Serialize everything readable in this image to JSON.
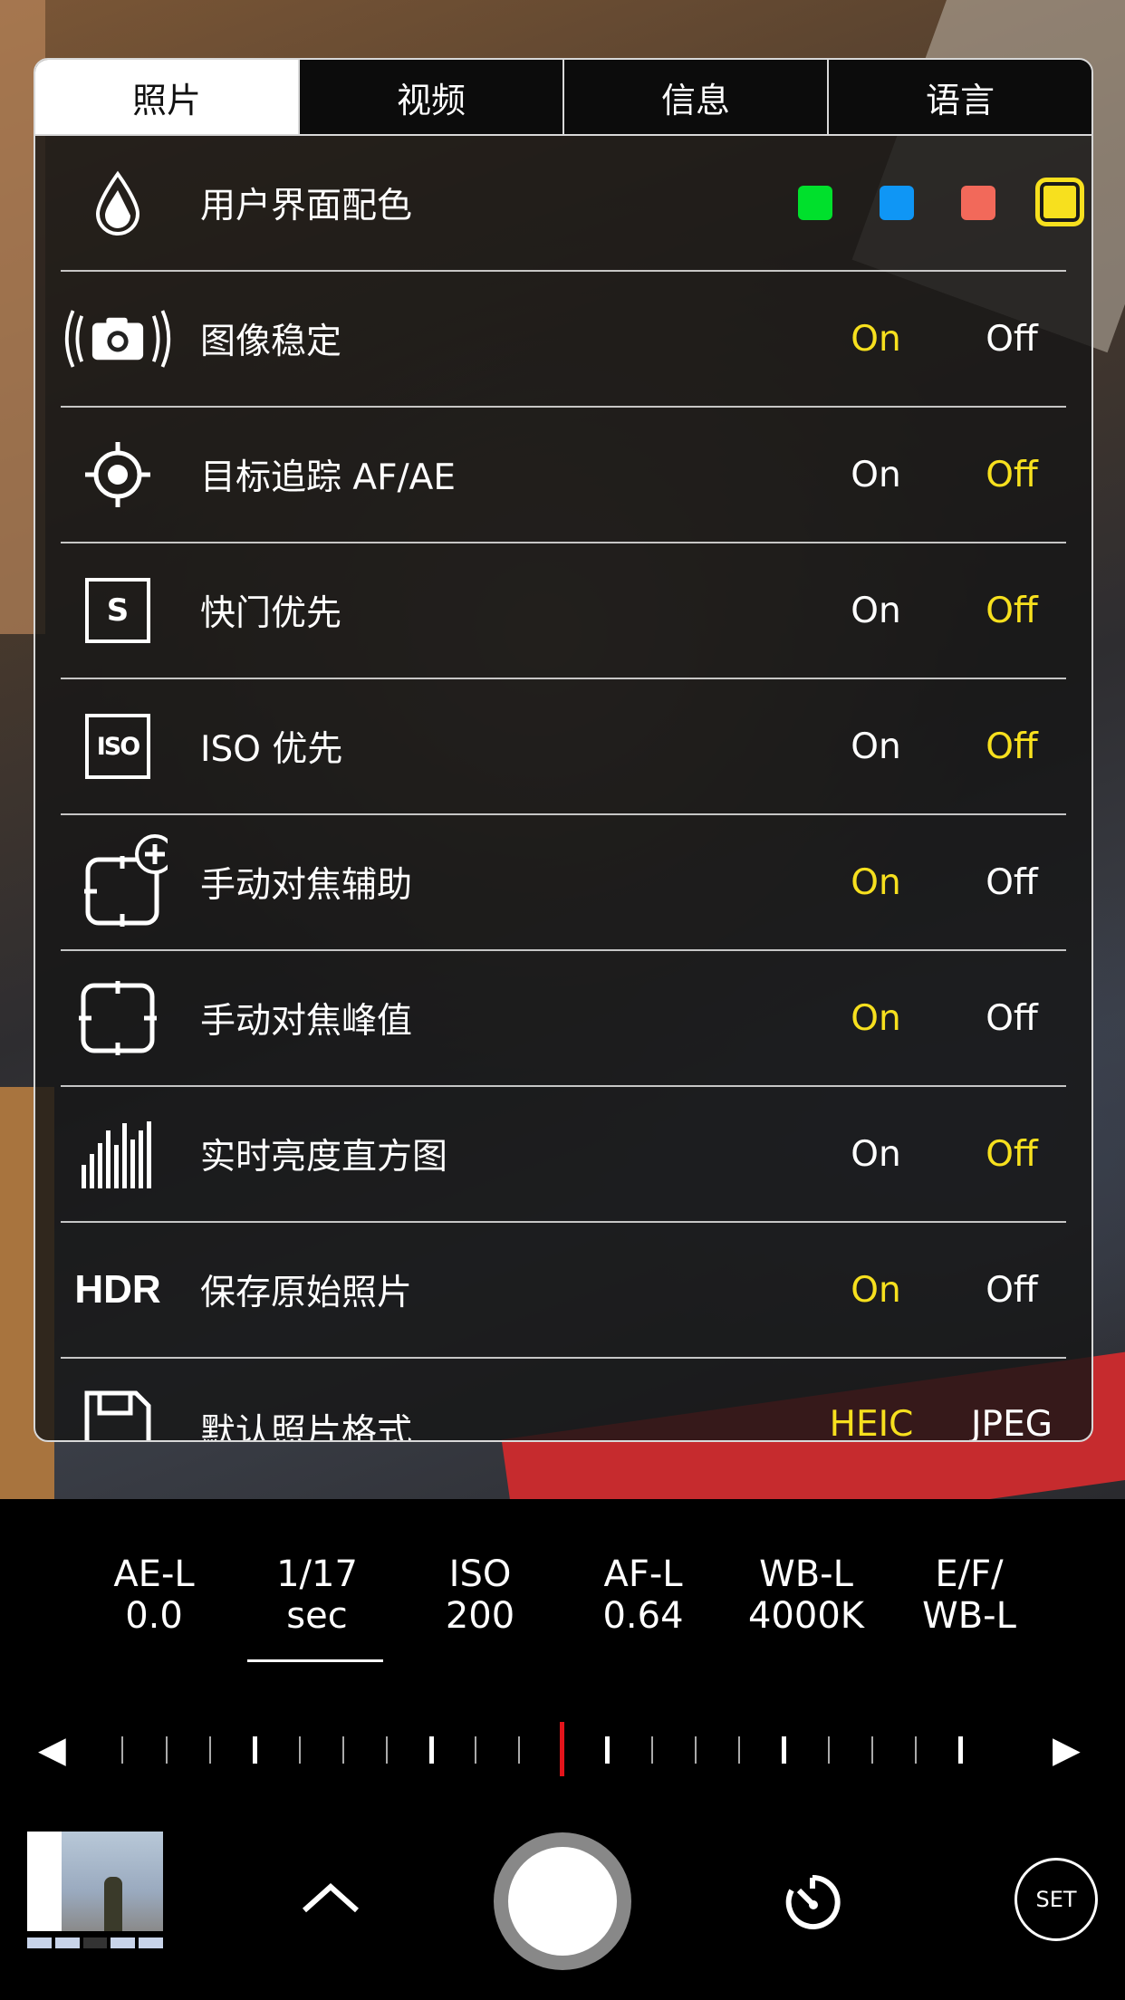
{
  "tabs": [
    "照片",
    "视频",
    "信息",
    "语言"
  ],
  "rows": [
    {
      "label": "用户界面配色",
      "icon": "droplet-icon"
    },
    {
      "label": "图像稳定",
      "icon": "camera-stabilization-icon",
      "on": "On",
      "off": "Off",
      "selected": "On"
    },
    {
      "label": "目标追踪 AF/AE",
      "icon": "crosshair-icon",
      "on": "On",
      "off": "Off",
      "selected": "Off"
    },
    {
      "label": "快门优先",
      "icon": "shutter-priority-icon",
      "icon_text": "S",
      "on": "On",
      "off": "Off",
      "selected": "Off"
    },
    {
      "label": "ISO 优先",
      "icon": "iso-priority-icon",
      "icon_text": "ISO",
      "on": "On",
      "off": "Off",
      "selected": "Off"
    },
    {
      "label": "手动对焦辅助",
      "icon": "focus-assist-icon",
      "on": "On",
      "off": "Off",
      "selected": "On"
    },
    {
      "label": "手动对焦峰值",
      "icon": "focus-peaking-icon",
      "on": "On",
      "off": "Off",
      "selected": "On"
    },
    {
      "label": "实时亮度直方图",
      "icon": "histogram-icon",
      "on": "On",
      "off": "Off",
      "selected": "Off"
    },
    {
      "label": "保存原始照片",
      "icon": "hdr-icon",
      "icon_text": "HDR",
      "on": "On",
      "off": "Off",
      "selected": "On"
    },
    {
      "label": "默认照片格式",
      "icon": "save-icon",
      "on": "HEIC",
      "off": "JPEG",
      "selected": "HEIC"
    }
  ],
  "color_swatches": [
    "#00e02c",
    "#0f96f5",
    "#f2695a",
    "#f7e01e"
  ],
  "selected_swatch": "#f7e01e",
  "accent_color": "#f7e01e",
  "params": [
    {
      "l1": "AE-L",
      "l2": "0.0"
    },
    {
      "l1": "1/17",
      "l2": "sec"
    },
    {
      "l1": "ISO",
      "l2": "200"
    },
    {
      "l1": "AF-L",
      "l2": "0.64"
    },
    {
      "l1": "WB-L",
      "l2": "4000K"
    },
    {
      "l1": "E/F/",
      "l2": "WB-L"
    }
  ],
  "active_param": "1/17 sec",
  "set_label": "SET"
}
